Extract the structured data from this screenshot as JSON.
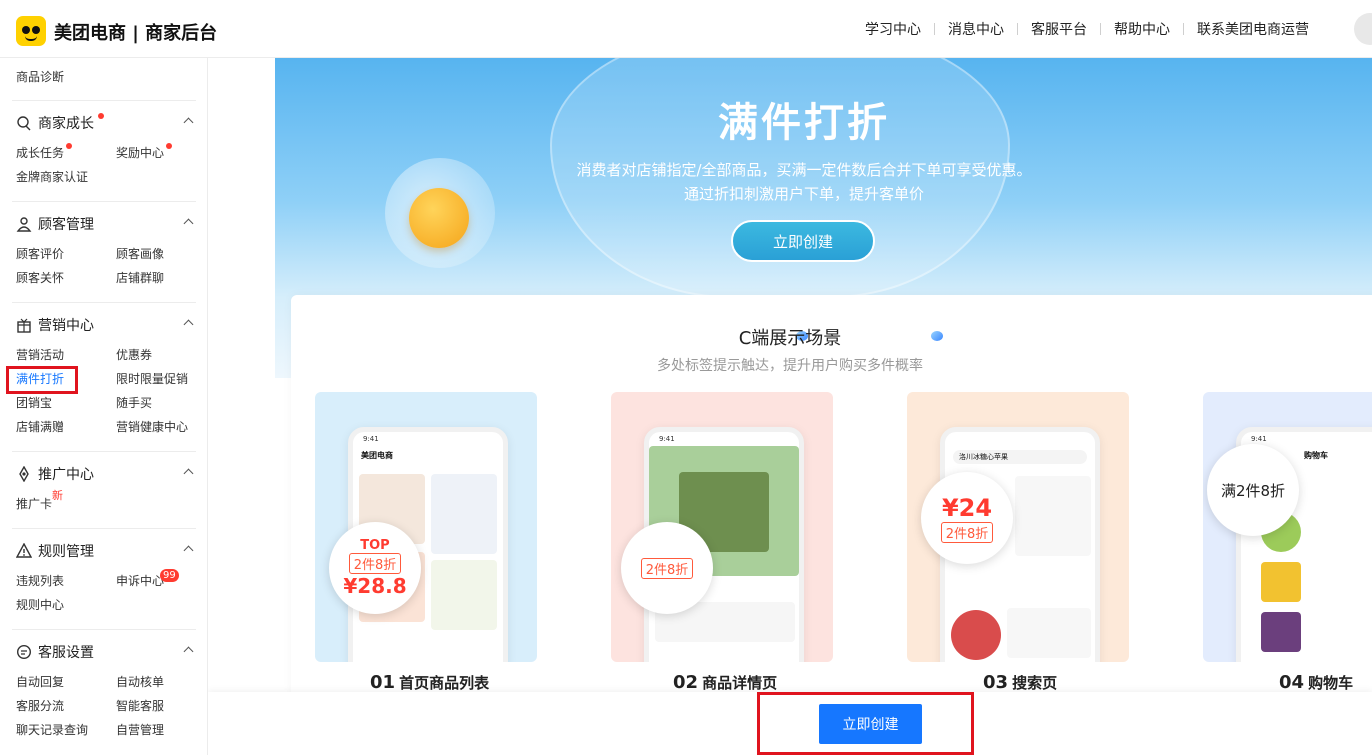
{
  "header": {
    "brand": "美团电商 | 商家后台",
    "nav": [
      "学习中心",
      "消息中心",
      "客服平台",
      "帮助中心",
      "联系美团电商运营"
    ]
  },
  "sidebar": {
    "top_item": "商品诊断",
    "sections": [
      {
        "title": "商家成长",
        "icon": "growth-icon",
        "dot": true,
        "items": [
          "成长任务",
          "奖励中心",
          "金牌商家认证"
        ]
      },
      {
        "title": "顾客管理",
        "icon": "user-icon",
        "items": [
          "顾客评价",
          "顾客画像",
          "顾客关怀",
          "店铺群聊"
        ]
      },
      {
        "title": "营销中心",
        "icon": "gift-icon",
        "items": [
          "营销活动",
          "优惠券",
          "满件打折",
          "限时限量促销",
          "团销宝",
          "随手买",
          "店铺满赠",
          "营销健康中心"
        ]
      },
      {
        "title": "推广中心",
        "icon": "promote-icon",
        "items": [
          "推广卡"
        ],
        "new_badge": "新"
      },
      {
        "title": "规则管理",
        "icon": "warning-icon",
        "items": [
          "违规列表",
          "申诉中心",
          "规则中心"
        ],
        "count_badge": "99"
      },
      {
        "title": "客服设置",
        "icon": "chat-icon",
        "items": [
          "自动回复",
          "自动核单",
          "客服分流",
          "智能客服",
          "聊天记录查询",
          "自营管理"
        ]
      }
    ],
    "active_item": "满件打折"
  },
  "banner": {
    "title": "满件打折",
    "desc_line1": "消费者对店铺指定/全部商品，买满一定件数后合并下单可享受优惠。",
    "desc_line2": "通过折扣刺激用户下单，提升客单价",
    "button": "立即创建"
  },
  "showcase": {
    "title": "C端展示场景",
    "subtitle": "多处标签提示触达，提升用户购买多件概率",
    "scenes": [
      {
        "num": "01",
        "label": "首页商品列表",
        "tag": "2件8折",
        "price": "¥28.8",
        "extra": "TOP"
      },
      {
        "num": "02",
        "label": "商品详情页",
        "tag": "2件8折",
        "price": "",
        "extra": ""
      },
      {
        "num": "03",
        "label": "搜索页",
        "tag": "2件8折",
        "price": "¥24",
        "extra": ""
      },
      {
        "num": "04",
        "label": "购物车",
        "tag": "满2件8折",
        "price": "",
        "extra": ""
      }
    ],
    "phone_texts": {
      "app": "美团电商",
      "search_hint": "洛川冰糖心苹果",
      "cart": "购物车",
      "time": "9:41"
    }
  },
  "footer": {
    "button": "立即创建"
  },
  "colors": {
    "primary": "#1677ff",
    "highlight": "#e0141e",
    "badge": "#ff3b30"
  }
}
